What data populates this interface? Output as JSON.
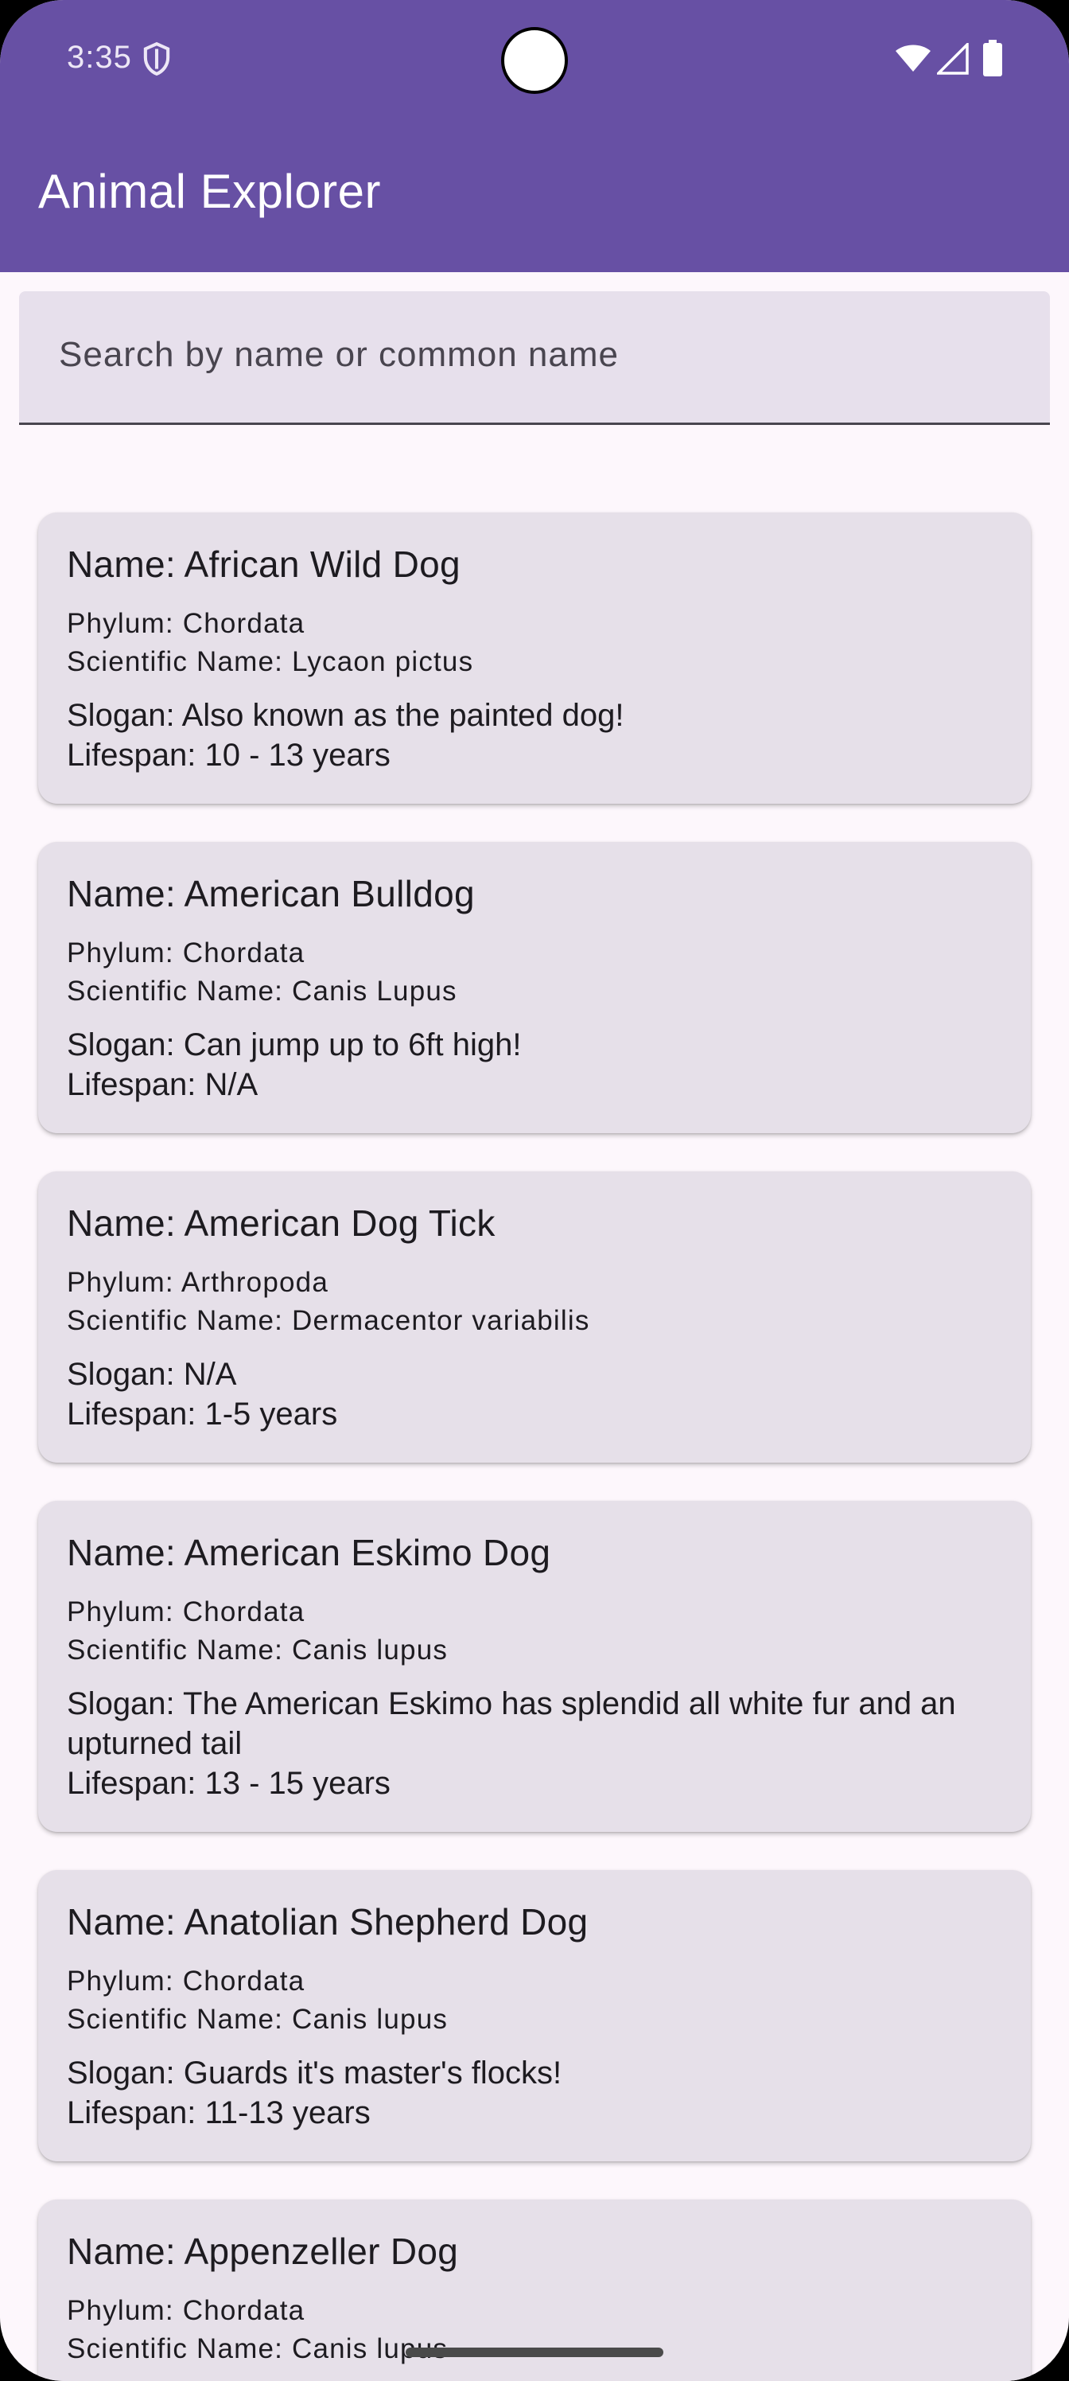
{
  "status_bar": {
    "time": "3:35",
    "icons": [
      "shield-icon",
      "wifi-icon",
      "signal-icon",
      "battery-icon"
    ]
  },
  "app_bar": {
    "title": "Animal Explorer",
    "color": "#6750a4"
  },
  "search": {
    "placeholder": "Search by name or common name",
    "value": ""
  },
  "animals": [
    {
      "name": "Name: African Wild Dog",
      "phylum": "Phylum: Chordata",
      "scientific": "Scientific Name: Lycaon pictus",
      "slogan": "Slogan: Also known as the painted dog!",
      "lifespan": "Lifespan: 10 - 13 years"
    },
    {
      "name": "Name: American Bulldog",
      "phylum": "Phylum: Chordata",
      "scientific": "Scientific Name: Canis Lupus",
      "slogan": "Slogan: Can jump up to 6ft high!",
      "lifespan": "Lifespan: N/A"
    },
    {
      "name": "Name: American Dog Tick",
      "phylum": "Phylum: Arthropoda",
      "scientific": "Scientific Name: Dermacentor variabilis",
      "slogan": "Slogan: N/A",
      "lifespan": "Lifespan: 1-5 years"
    },
    {
      "name": "Name: American Eskimo Dog",
      "phylum": "Phylum: Chordata",
      "scientific": "Scientific Name: Canis lupus",
      "slogan": "Slogan: The American Eskimo has splendid all white fur and an upturned tail",
      "lifespan": "Lifespan: 13 - 15 years"
    },
    {
      "name": "Name: Anatolian Shepherd Dog",
      "phylum": "Phylum: Chordata",
      "scientific": "Scientific Name: Canis lupus",
      "slogan": "Slogan: Guards it's master's flocks!",
      "lifespan": "Lifespan: 11-13 years"
    },
    {
      "name": "Name: Appenzeller Dog",
      "phylum": "Phylum: Chordata",
      "scientific": "Scientific Name: Canis lupus",
      "slogan": "",
      "lifespan": ""
    }
  ]
}
